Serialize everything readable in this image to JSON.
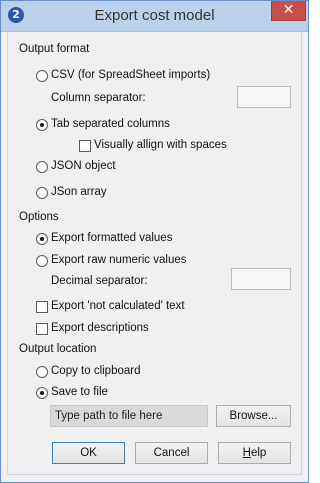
{
  "window": {
    "title": "Export cost model",
    "close_glyph": "✕",
    "icon_letter": "2",
    "accent_color": "#c7504a"
  },
  "output_format": {
    "heading": "Output format",
    "csv_label": "CSV (for SpreadSheet imports)",
    "column_separator_label": "Column separator:",
    "column_separator_value": "",
    "tab_label": "Tab separated columns",
    "visually_align_label": "Visually allign with spaces",
    "json_object_label": "JSON object",
    "json_array_label": "JSon array",
    "selected": "tab"
  },
  "options": {
    "heading": "Options",
    "formatted_label": "Export formatted values",
    "raw_label": "Export raw numeric values",
    "decimal_separator_label": "Decimal separator:",
    "decimal_separator_value": "",
    "not_calculated_label": "Export 'not calculated' text",
    "descriptions_label": "Export descriptions",
    "selected": "formatted"
  },
  "output_location": {
    "heading": "Output location",
    "clipboard_label": "Copy to clipboard",
    "save_label": "Save to file",
    "path_placeholder": "Type path to file here",
    "browse_label": "Browse...",
    "selected": "file"
  },
  "buttons": {
    "ok": "OK",
    "cancel": "Cancel",
    "help_rest": "elp",
    "help_underline": "H"
  }
}
